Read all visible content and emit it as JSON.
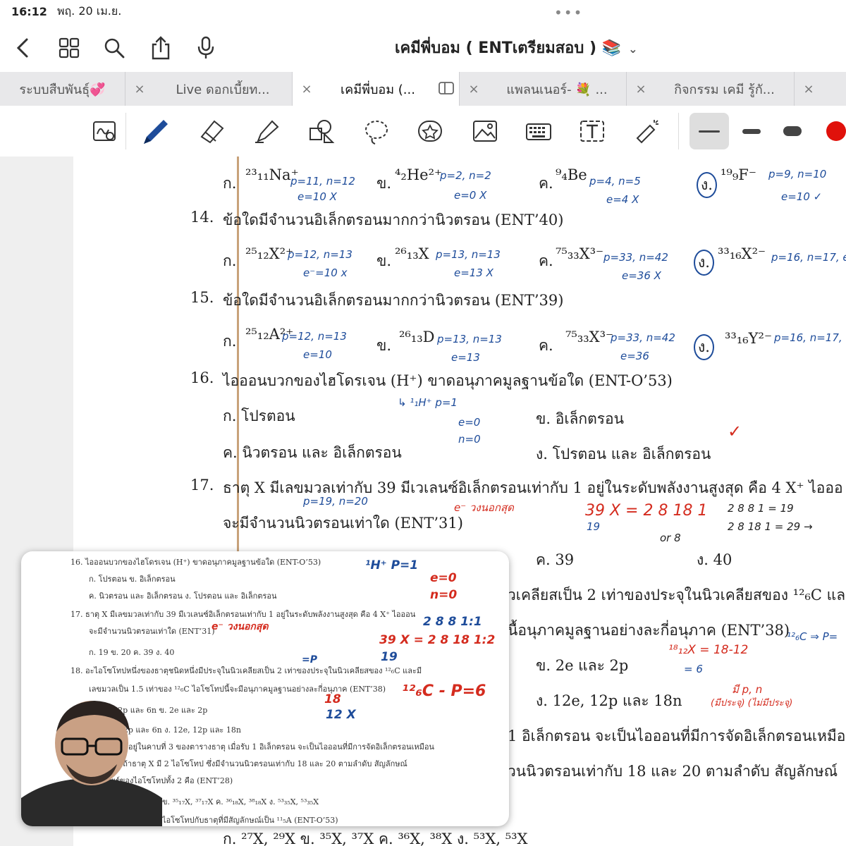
{
  "status": {
    "time": "16:12",
    "date": "พฤ. 20 เม.ย."
  },
  "nav": {
    "title": "เคมีพี่บอม ( ENTเตรียมสอบ ) 📚"
  },
  "icons": {
    "back": "chevron-left-icon",
    "grid": "grid-icon",
    "search": "search-icon",
    "share": "share-icon",
    "mic": "microphone-icon",
    "dropdown": "chevron-down-icon",
    "close": "close-icon"
  },
  "tabs": [
    {
      "label": "ระบบสืบพันธุ์💞"
    },
    {
      "label": "Live ดอกเบี้ยท..."
    },
    {
      "label": "เคมีพี่บอม (..."
    },
    {
      "label": "แพลนเนอร์- 💐 ..."
    },
    {
      "label": "กิจกรรม เคมี รู้กั..."
    }
  ],
  "tab_close": "×",
  "colors": {
    "ink_blue": "#1e4c9a",
    "ink_red": "#d42b1e",
    "highlight": "#f8c98a",
    "pen_red": "#e0110b"
  },
  "doc": {
    "row13": {
      "a": "ก.",
      "a_elem": "²³₁₁Na⁺",
      "a_note": "p=11, n=12",
      "a_note2": "e=10 X",
      "b": "ข.",
      "b_elem": "⁴₂He²⁺",
      "b_note": "p=2, n=2",
      "b_note2": "e=0 X",
      "c": "ค.",
      "c_elem": "⁹₄Be",
      "c_note": "p=4, n=5",
      "c_note2": "e=4 X",
      "d": "ง.",
      "d_elem": "¹⁹₉F⁻",
      "d_note": "p=9, n=10",
      "d_note2": "e=10 ✓"
    },
    "q14": {
      "num": "14.",
      "text": "ข้อใดมีจำนวนอิเล็กตรอนมากกว่านิวตรอน (ENT’40)"
    },
    "row14": {
      "a": "ก.",
      "a_elem": "²⁵₁₂X²⁺",
      "a_note": "p=12, n=13",
      "a_note2": "e⁻=10 x",
      "b": "ข.",
      "b_elem": "²⁶₁₃X",
      "b_note": "p=13, n=13",
      "b_note2": "e=13 X",
      "c": "ค.",
      "c_elem": "⁷⁵₃₃X³⁻",
      "c_note": "p=33, n=42",
      "c_note2": "e=36 X",
      "d": "ง.",
      "d_elem": "³³₁₆X²⁻",
      "d_note": "p=16, n=17, e"
    },
    "q15": {
      "num": "15.",
      "text": "ข้อใดมีจำนวนอิเล็กตรอนมากกว่านิวตรอน (ENT’39)"
    },
    "row15": {
      "a": "ก.",
      "a_elem": "²⁵₁₂A²⁺",
      "a_note": "p=12, n=13",
      "a_note2": "e=10",
      "b": "ข.",
      "b_elem": "²⁶₁₃D",
      "b_note": "p=13, n=13",
      "b_note2": "e=13",
      "c": "ค.",
      "c_elem": "⁷⁵₃₃X³⁻",
      "c_note": "p=33, n=42",
      "c_note2": "e=36",
      "d": "ง.",
      "d_elem": "³³₁₆Y²⁻",
      "d_note": "p=16, n=17, e"
    },
    "q16": {
      "num": "16.",
      "text": "ไอออนบวกของไฮโดรเจน (H⁺) ขาดอนุภาคมูลฐานข้อใด (ENT-O’53)"
    },
    "row16": {
      "a": "ก. โปรตอน",
      "b": "ข. อิเล็กตรอน",
      "c": "ค. นิวตรอน และ อิเล็กตรอน",
      "d": "ง. โปรตอน และ อิเล็กตรอน",
      "note1": "↳ ¹₁H⁺  p=1",
      "note2": "e=0",
      "note3": "n=0",
      "check": "✓"
    },
    "q17": {
      "num": "17.",
      "text": "ธาตุ X มีเลขมวลเท่ากับ 39 มีเวเลนซ์อิเล็กตรอนเท่ากับ 1 อยู่ในระดับพลังงานสูงสุด คือ 4  X⁺ ไอออ",
      "text2": "จะมีจำนวนนิวตรอนเท่าใด (ENT’31)",
      "note1": "p=19, n=20",
      "note2": "e⁻ วงนอกสุด",
      "note3": "39 X = 2 8 18 1",
      "note3b": "19",
      "note4": "or 8",
      "note5": "2 8 8 1 = 19",
      "note6": "2 8 18 1 = 29 →",
      "c": "ค. 39",
      "d": "ง. 40"
    },
    "q18": {
      "text": "วเคลียสเป็น 2 เท่าของประจุในนิวเคลียสของ ¹²₆C และ",
      "text2": "นื้อนุภาคมูลฐานอย่างละกี่อนุภาค (ENT’38)",
      "b": "ข. 2e และ 2p",
      "d": "ง. 12e, 12p และ 18n",
      "note1": "¹⁸₁₂X = 18-12",
      "note2": "= 6",
      "note3": "มี p, n",
      "note4": "(มีประจุ) (ไม่มีประจุ)",
      "note5": "¹²₆C ⇒ P="
    },
    "q19": {
      "text": "1 อิเล็กตรอน จะเป็นไอออนที่มีการจัดอิเล็กตรอนเหมือน",
      "text2": "วนนิวตรอนเท่ากับ 18 และ 20 ตามลำดับ สัญลักษณ์",
      "opts": "ก. ²⁷X, ²⁹X          ข. ³⁵X, ³⁷X          ค. ³⁶X, ³⁸X          ง. ⁵³X, ⁵³X"
    }
  },
  "pip": {
    "lines": [
      "16.  ไอออนบวกของไฮโดรเจน (H⁺) ขาดอนุภาคมูลฐานข้อใด  (ENT-O’53)",
      "ก. โปรตอน                                   ข. อิเล็กตรอน",
      "ค. นิวตรอน และ อิเล็กตรอน                   ง. โปรตอน และ อิเล็กตรอน",
      "17.  ธาตุ X มีเลขมวลเท่ากับ 39 มีเวเลนซ์อิเล็กตรอนเท่ากับ 1 อยู่ในระดับพลังงานสูงสุด คือ 4  X⁺ ไอออน",
      "จะมีจำนวนนิวตรอนเท่าใด (ENT’31)",
      "ก. 19                  ข. 20                  ค. 39              ง. 40",
      "18.  อะไอโซโทปหนึ่งของธาตุชนิดหนึ่งมีประจุในนิวเคลียสเป็น 2 เท่าของประจุในนิวเคลียสของ ¹²₆C และมี",
      "เลขมวลเป็น 1.5 เท่าของ ¹²₆C ไอโซโทปนี้จะมีอนุภาคมูลฐานอย่างละกี่อนุภาค (ENT’38)",
      "ก. 6e, 12p และ 6n                           ข. 2e และ 2p",
      "ค. 12e, 12p และ 6n                          ง. 12e, 12p และ 18n",
      "19.  ธาตุ X อยู่ในคาบที่ 3 ของตารางธาตุ เมื่อรับ 1 อิเล็กตรอน จะเป็นไอออนที่มีการจัดอิเล็กตรอนเหมือน",
      "แก๊สเฉื่อย ถ้าธาตุ X มี 2 ไอโซโทป ซึ่งมีจำนวนนิวตรอนเท่ากับ 18 และ 20 ตามลำดับ สัญลักษณ์",
      "นิวเคลียร์ของไอโซโทปทั้ง 2 คือ (ENT’28)",
      "ข. ³⁵₁₇X, ³⁷₁₇X         ค. ³⁶₁₈X, ³⁸₁₈X          ง. ⁵³₃₅X, ⁵³₃₅X",
      "ไอโซโทปกับธาตุที่มีสัญลักษณ์เป็น ¹¹₅A (ENT-O’53)"
    ],
    "hand1": "¹H⁺  P=1",
    "hand2": "e=0",
    "hand3": "n=0",
    "hand4": "2 8 8 1:1",
    "hand5": "39 X = 2 8 18 1:2",
    "hand5b": "19",
    "hand6": "e⁻ วงนอกสุด",
    "hand7": "=P",
    "hand8": "¹²₆C - P=6",
    "hand9": "18",
    "hand10": "12 X"
  }
}
